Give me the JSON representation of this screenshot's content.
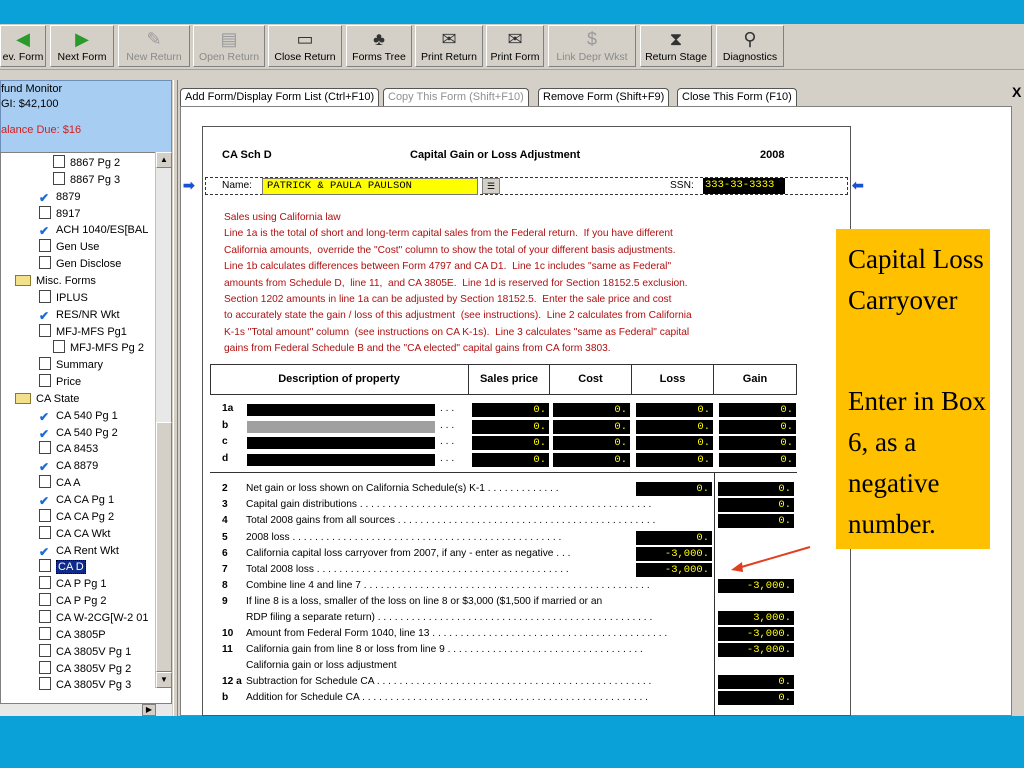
{
  "toolbar": {
    "buttons": [
      {
        "label": "ev. Form",
        "disabled": false
      },
      {
        "label": "Next Form",
        "disabled": false
      },
      {
        "label": "New Return",
        "disabled": true
      },
      {
        "label": "Open Return",
        "disabled": true
      },
      {
        "label": "Close Return",
        "disabled": false
      },
      {
        "label": "Forms Tree",
        "disabled": false
      },
      {
        "label": "Print Return",
        "disabled": false
      },
      {
        "label": "Print Form",
        "disabled": false
      },
      {
        "label": "Link Depr Wkst",
        "disabled": true
      },
      {
        "label": "Return Stage",
        "disabled": false
      },
      {
        "label": "Diagnostics",
        "disabled": false
      }
    ]
  },
  "monitor": {
    "title": "fund Monitor",
    "agi": "GI: $42,100",
    "balance": "alance Due: $16"
  },
  "tree": {
    "items": [
      {
        "label": "8867 Pg 2",
        "icon": "doc"
      },
      {
        "label": "8867 Pg 3",
        "icon": "doc"
      },
      {
        "label": "8879",
        "icon": "check"
      },
      {
        "label": "8917",
        "icon": "doc"
      },
      {
        "label": "ACH 1040/ES[BAL",
        "icon": "check"
      },
      {
        "label": "Gen Use",
        "icon": "doc"
      },
      {
        "label": "Gen Disclose",
        "icon": "doc"
      },
      {
        "label": "Misc. Forms",
        "icon": "folder"
      },
      {
        "label": "IPLUS",
        "icon": "doc"
      },
      {
        "label": "RES/NR Wkt",
        "icon": "check"
      },
      {
        "label": "MFJ-MFS Pg1",
        "icon": "doc"
      },
      {
        "label": "MFJ-MFS Pg 2",
        "icon": "doc"
      },
      {
        "label": "Summary",
        "icon": "doc"
      },
      {
        "label": "Price",
        "icon": "doc"
      },
      {
        "label": "CA State",
        "icon": "folder"
      },
      {
        "label": "CA 540 Pg 1",
        "icon": "check"
      },
      {
        "label": "CA 540 Pg 2",
        "icon": "check"
      },
      {
        "label": "CA 8453",
        "icon": "doc"
      },
      {
        "label": "CA 8879",
        "icon": "check"
      },
      {
        "label": "CA A",
        "icon": "doc"
      },
      {
        "label": "CA CA Pg 1",
        "icon": "check"
      },
      {
        "label": "CA CA Pg 2",
        "icon": "doc"
      },
      {
        "label": "CA CA Wkt",
        "icon": "doc"
      },
      {
        "label": "CA Rent Wkt",
        "icon": "check"
      },
      {
        "label": "CA D",
        "icon": "doc",
        "selected": true
      },
      {
        "label": "CA P Pg 1",
        "icon": "doc"
      },
      {
        "label": "CA P Pg 2",
        "icon": "doc"
      },
      {
        "label": "CA W-2CG[W-2 01",
        "icon": "doc"
      },
      {
        "label": "CA 3805P",
        "icon": "doc"
      },
      {
        "label": "CA 3805V Pg 1",
        "icon": "doc"
      },
      {
        "label": "CA 3805V Pg 2",
        "icon": "doc"
      },
      {
        "label": "CA 3805V Pg 3",
        "icon": "doc"
      }
    ]
  },
  "tabs": [
    {
      "label": "Add Form/Display Form List (Ctrl+F10)",
      "disabled": false
    },
    {
      "label": "Copy This Form (Shift+F10)",
      "disabled": true
    },
    {
      "label": "Remove Form (Shift+F9)",
      "disabled": false
    },
    {
      "label": "Close This Form (F10)",
      "disabled": false
    }
  ],
  "form": {
    "code": "CA Sch D",
    "title": "Capital Gain or Loss Adjustment",
    "year": "2008",
    "name_label": "Name:",
    "name_value": "PATRICK & PAULA PAULSON",
    "ssn_label": "SSN:",
    "ssn_value": "333-33-3333",
    "instructions": [
      "Sales using California law",
      "Line 1a is the total of short and long-term capital sales from the Federal return.  If you have different",
      "California amounts,  override the \"Cost\" column to show the total of your different basis adjustments.",
      "Line 1b calculates differences between Form 4797 and CA D1.  Line 1c includes \"same as Federal\"",
      "amounts from Schedule D,  line 11,  and CA 3805E.  Line 1d is reserved for Section 18152.5 exclusion.",
      "Section 1202 amounts in line 1a can be adjusted by Section 18152.5.  Enter the sale price and cost",
      "to accurately state the gain / loss of this adjustment  (see instructions).  Line 2 calculates from California",
      "K-1s \"Total amount\" column  (see instructions on CA K-1s).  Line 3 calculates \"same as Federal\" capital",
      "gains from Federal Schedule B and the \"CA elected\" capital gains from CA form 3803."
    ],
    "columns": [
      "Description of property",
      "Sales price",
      "Cost",
      "Loss",
      "Gain"
    ],
    "rows1": [
      {
        "no": "1a",
        "values": [
          "0.",
          "0.",
          "0.",
          "0."
        ]
      },
      {
        "no": "b",
        "values": [
          "0.",
          "0.",
          "0.",
          "0."
        ]
      },
      {
        "no": "c",
        "values": [
          "0.",
          "0.",
          "0.",
          "0."
        ]
      },
      {
        "no": "d",
        "values": [
          "0.",
          "0.",
          "0.",
          "0."
        ]
      }
    ],
    "lines": [
      {
        "no": "2",
        "text": "Net gain or loss shown on California Schedule(s)  K-1  . . . . . . . . . . . . .",
        "loss": "0.",
        "gain": "0."
      },
      {
        "no": "3",
        "text": "Capital gain distributions . . . . . . . . . . . . . . . . . . . . . . . . . . . . . . . . . . . . . . . . . . . . . . . . . . . .",
        "loss": null,
        "gain": "0."
      },
      {
        "no": "4",
        "text": "Total 2008 gains from all sources . . . . . . . . . . . . . . . . . . . . . . . . . . . . . . . . . . . . . . . . . . . . . .",
        "loss": null,
        "gain": "0."
      },
      {
        "no": "5",
        "text": "2008 loss . . . . . . . . . . . . . . . . . . . . . . . . . . . . . . . . . . . . . . . . . . . . . . . .",
        "loss": "0.",
        "gain": null
      },
      {
        "no": "6",
        "text": "California capital loss carryover from 2007,  if any - enter as negative . . .",
        "loss": "-3,000.",
        "gain": null
      },
      {
        "no": "7",
        "text": "Total 2008 loss  . . . . . . . . . . . . . . . . . . . . . . . . . . . . . . . . . . . . . . . . . . . . .",
        "loss": "-3,000.",
        "gain": null
      },
      {
        "no": "8",
        "text": "Combine line 4 and line 7 . . . . . . . . . . . . . . . . . . . . . . . . . . . . . . . . . . . . . . . . . . . . . . . . . . .",
        "loss": null,
        "gain": "-3,000."
      },
      {
        "no": "9",
        "text": "If line 8 is a loss,  smaller of the loss on line 8 or $3,000  ($1,500 if married or an",
        "loss": null,
        "gain": null
      },
      {
        "no": "",
        "text": "RDP filing a separate return) . . . . . . . . . . . . . . . . . . . . . . . . . . . . . . . . . . . . . . . . . . . . . . . . .",
        "loss": null,
        "gain": "3,000."
      },
      {
        "no": "10",
        "text": "Amount from Federal Form 1040,  line 13 . . . . . . . . . . . . . . . . . . . . . . . . . . . . . . . . . . . . . . . . . .",
        "loss": null,
        "gain": "-3,000."
      },
      {
        "no": "11",
        "text": "California gain from line 8 or loss from line 9  . . . . . . . . . . . . . . . . . . . . . . . . . . . . . . . . . . .",
        "loss": null,
        "gain": "-3,000."
      },
      {
        "no": "",
        "text": "California gain or loss adjustment",
        "loss": null,
        "gain": null
      },
      {
        "no": "12 a",
        "text": "Subtraction for Schedule CA . . . . . . . . . . . . . . . . . . . . . . . . . . . . . . . . . . . . . . . . . . . . . . . . .",
        "loss": null,
        "gain": "0."
      },
      {
        "no": "b",
        "text": "Addition for Schedule CA  . . . . . . . . . . . . . . . . . . . . . . . . . . . . . . . . . . . . . . . . . . . . . . . . . . .",
        "loss": null,
        "gain": "0."
      }
    ]
  },
  "callout": {
    "title": "Capital Loss Carryover",
    "body": "Enter in Box 6, as a negative number."
  },
  "colors": {
    "background": "#0aa0d8",
    "callout": "#ffc000",
    "instructions": "#b01010",
    "highlight": "#ffff00",
    "arrow": "#e04020"
  }
}
